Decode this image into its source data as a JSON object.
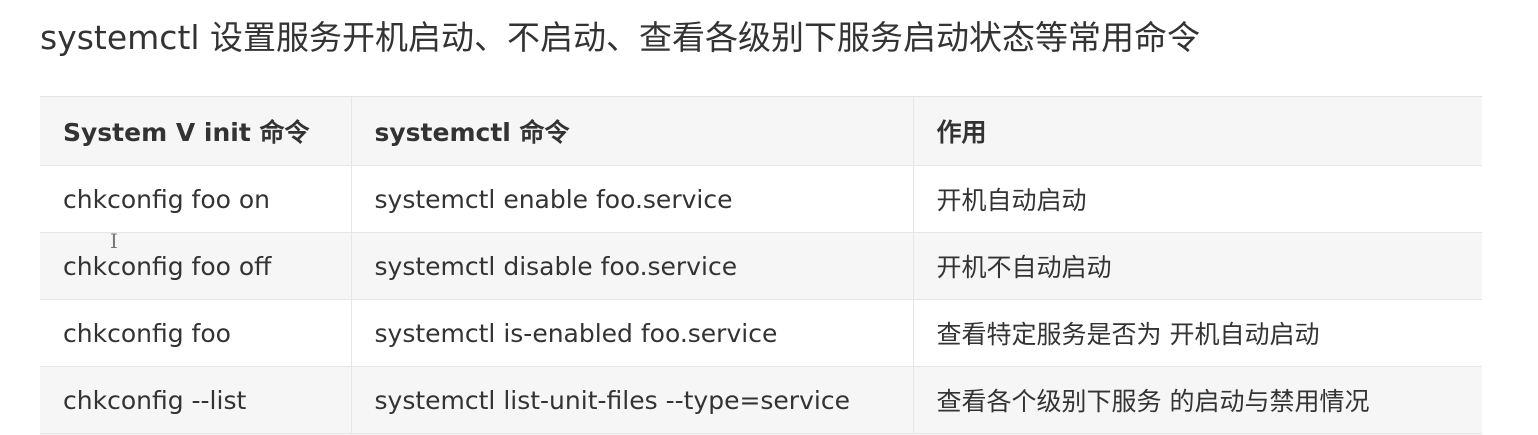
{
  "heading": "systemctl 设置服务开机启动、不启动、查看各级别下服务启动状态等常用命令",
  "table": {
    "headers": [
      "System V init 命令",
      "systemctl 命令",
      "作用"
    ],
    "rows": [
      [
        "chkconfig foo on",
        "systemctl enable foo.service",
        "开机自动启动"
      ],
      [
        "chkconfig foo off",
        "systemctl disable foo.service",
        "开机不自动启动"
      ],
      [
        "chkconfig foo",
        "systemctl is-enabled foo.service",
        "查看特定服务是否为 开机自动启动"
      ],
      [
        "chkconfig --list",
        "systemctl list-unit-files --type=service",
        "查看各个级别下服务 的启动与禁用情况"
      ]
    ]
  },
  "cursor_icon": "text-cursor-icon"
}
